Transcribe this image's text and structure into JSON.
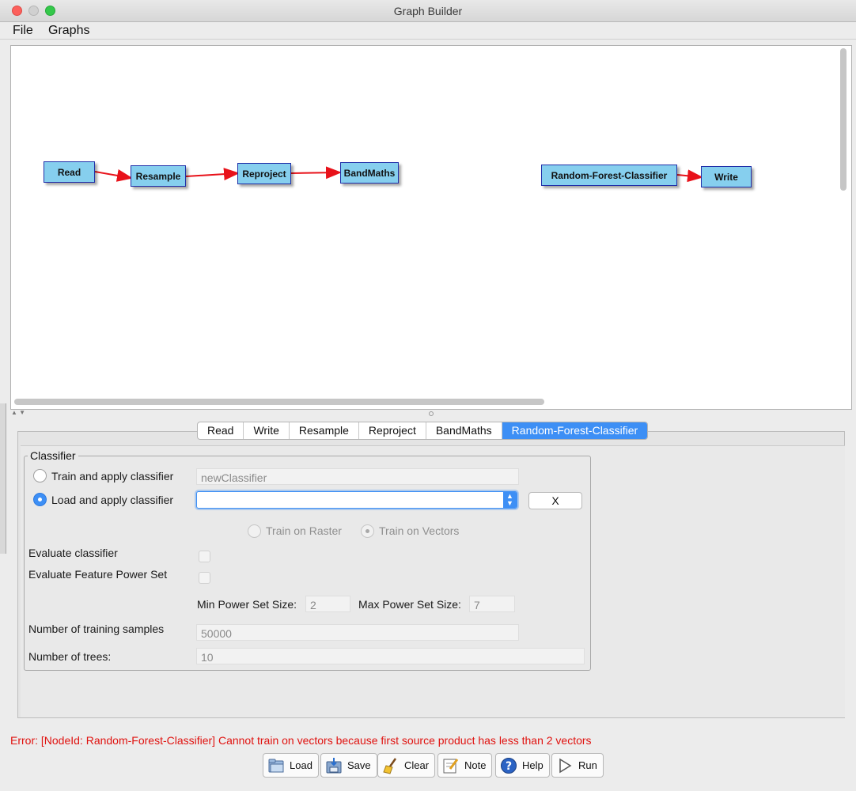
{
  "window": {
    "title": "Graph Builder"
  },
  "menu": {
    "items": [
      "File",
      "Graphs"
    ]
  },
  "graph": {
    "nodes": [
      "Read",
      "Resample",
      "Reproject",
      "BandMaths",
      "Random-Forest-Classifier",
      "Write"
    ]
  },
  "tabs": [
    "Read",
    "Write",
    "Resample",
    "Reproject",
    "BandMaths",
    "Random-Forest-Classifier"
  ],
  "active_tab": "Random-Forest-Classifier",
  "classifier": {
    "group_title": "Classifier",
    "train_apply_label": "Train and apply classifier",
    "train_apply_value": "newClassifier",
    "load_apply_label": "Load and apply classifier",
    "load_apply_value": "",
    "load_selected": true,
    "clear_label": "X",
    "train_on_raster_label": "Train on Raster",
    "train_on_vectors_label": "Train on Vectors",
    "train_on_vectors_selected": true,
    "evaluate_classifier_label": "Evaluate classifier",
    "evaluate_feature_power_set_label": "Evaluate Feature Power Set",
    "min_power_set_label": "Min Power Set Size:",
    "min_power_set_value": "2",
    "max_power_set_label": "Max Power Set Size:",
    "max_power_set_value": "7",
    "training_samples_label": "Number of training samples",
    "training_samples_value": "50000",
    "trees_label": "Number of trees:",
    "trees_value": "10"
  },
  "status": {
    "error": "Error: [NodeId: Random-Forest-Classifier] Cannot train on vectors because first source product has less than 2 vectors"
  },
  "buttons": {
    "load": "Load",
    "save": "Save",
    "clear": "Clear",
    "note": "Note",
    "help": "Help",
    "run": "Run"
  },
  "colors": {
    "accent": "#3d8ff5",
    "node_fill": "#86cfee",
    "edge": "#e8121a",
    "error_text": "#e0120f"
  }
}
